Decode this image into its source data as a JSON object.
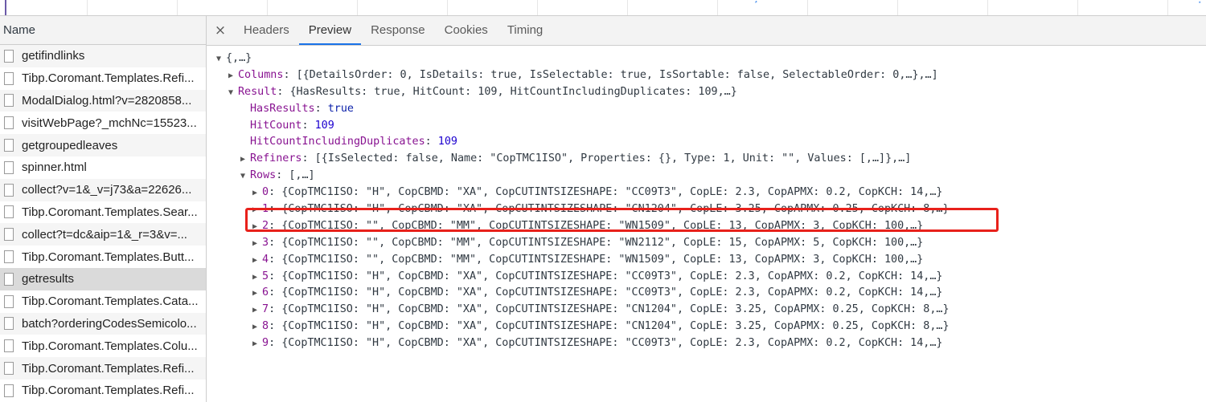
{
  "left": {
    "header": "Name",
    "requests": [
      "getifindlinks",
      "Tibp.Coromant.Templates.Refi...",
      "ModalDialog.html?v=2820858...",
      "visitWebPage?_mchNc=15523...",
      "getgroupedleaves",
      "spinner.html",
      "collect?v=1&_v=j73&a=22626...",
      "Tibp.Coromant.Templates.Sear...",
      "collect?t=dc&aip=1&_r=3&v=...",
      "Tibp.Coromant.Templates.Butt...",
      "getresults",
      "Tibp.Coromant.Templates.Cata...",
      "batch?orderingCodesSemicolo...",
      "Tibp.Coromant.Templates.Colu...",
      "Tibp.Coromant.Templates.Refi...",
      "Tibp.Coromant.Templates.Refi..."
    ]
  },
  "tabs": {
    "close": "×",
    "items": [
      "Headers",
      "Preview",
      "Response",
      "Cookies",
      "Timing"
    ]
  },
  "preview": {
    "root": "{,…}",
    "columns_key": "Columns",
    "columns_val": "[{DetailsOrder: 0, IsDetails: true, IsSelectable: true, IsSortable: false, SelectableOrder: 0,…},…]",
    "result_key": "Result",
    "result_val": "{HasResults: true, HitCount: 109, HitCountIncludingDuplicates: 109,…}",
    "hasresults_key": "HasResults",
    "hasresults_val": "true",
    "hitcount_key": "HitCount",
    "hitcount_val": "109",
    "hitdup_key": "HitCountIncludingDuplicates",
    "hitdup_val": "109",
    "refiners_key": "Refiners",
    "refiners_val": "[{IsSelected: false, Name: \"CopTMC1ISO\", Properties: {}, Type: 1, Unit: \"\", Values: [,…]},…]",
    "rows_key": "Rows",
    "rows_val": "[,…]",
    "rows": [
      "{CopTMC1ISO: \"H\", CopCBMD: \"XA\", CopCUTINTSIZESHAPE: \"CC09T3\", CopLE: 2.3, CopAPMX: 0.2, CopKCH: 14,…}",
      "{CopTMC1ISO: \"H\", CopCBMD: \"XA\", CopCUTINTSIZESHAPE: \"CN1204\", CopLE: 3.25, CopAPMX: 0.25, CopKCH: 8,…}",
      "{CopTMC1ISO: \"\", CopCBMD: \"MM\", CopCUTINTSIZESHAPE: \"WN1509\", CopLE: 13, CopAPMX: 3, CopKCH: 100,…}",
      "{CopTMC1ISO: \"\", CopCBMD: \"MM\", CopCUTINTSIZESHAPE: \"WN2112\", CopLE: 15, CopAPMX: 5, CopKCH: 100,…}",
      "{CopTMC1ISO: \"\", CopCBMD: \"MM\", CopCUTINTSIZESHAPE: \"WN1509\", CopLE: 13, CopAPMX: 3, CopKCH: 100,…}",
      "{CopTMC1ISO: \"H\", CopCBMD: \"XA\", CopCUTINTSIZESHAPE: \"CC09T3\", CopLE: 2.3, CopAPMX: 0.2, CopKCH: 14,…}",
      "{CopTMC1ISO: \"H\", CopCBMD: \"XA\", CopCUTINTSIZESHAPE: \"CC09T3\", CopLE: 2.3, CopAPMX: 0.2, CopKCH: 14,…}",
      "{CopTMC1ISO: \"H\", CopCBMD: \"XA\", CopCUTINTSIZESHAPE: \"CN1204\", CopLE: 3.25, CopAPMX: 0.25, CopKCH: 8,…}",
      "{CopTMC1ISO: \"H\", CopCBMD: \"XA\", CopCUTINTSIZESHAPE: \"CN1204\", CopLE: 3.25, CopAPMX: 0.25, CopKCH: 8,…}",
      "{CopTMC1ISO: \"H\", CopCBMD: \"XA\", CopCUTINTSIZESHAPE: \"CC09T3\", CopLE: 2.3, CopAPMX: 0.2, CopKCH: 14,…}"
    ]
  },
  "colors": {
    "highlight": "#e8211b",
    "tab_active": "#1a73e8",
    "key": "#881391",
    "string": "#c41a16",
    "number": "#1c00cf"
  }
}
